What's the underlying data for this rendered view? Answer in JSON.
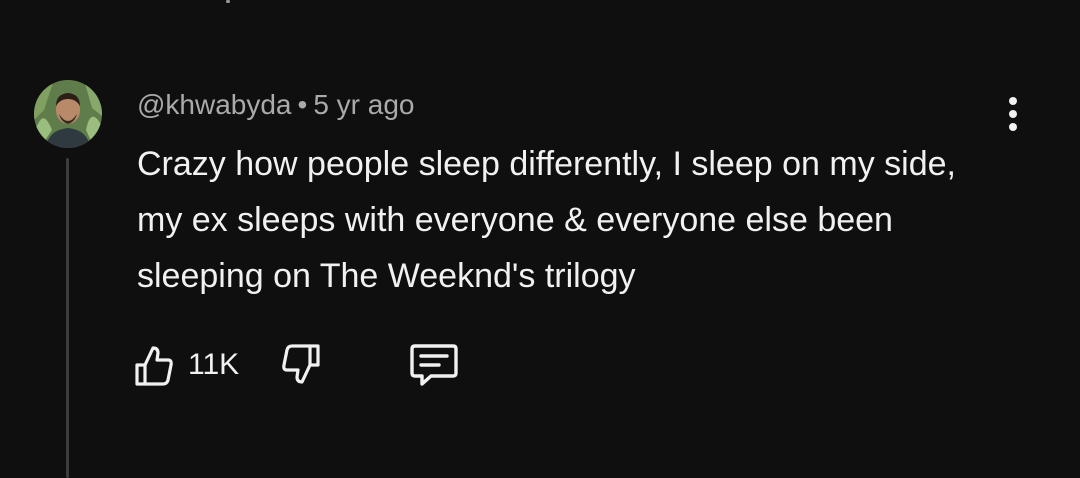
{
  "comment": {
    "author": "@khwabyda",
    "separator": "•",
    "time": "5 yr ago",
    "text": "Crazy how people sleep differently, I sleep on my side, my ex sleeps with everyone & everyone else been sleeping on The Weeknd's trilogy",
    "avatar_icon": "user-avatar-photo",
    "more_icon": "more-vertical-icon"
  },
  "actions": {
    "like_icon": "thumbs-up-icon",
    "like_count": "11K",
    "dislike_icon": "thumbs-down-icon",
    "reply_icon": "comment-reply-icon"
  },
  "colors": {
    "background": "#0f0f0f",
    "text_primary": "#f1f1f1",
    "text_secondary": "#aaaaaa",
    "thread_line": "#3d3d3d"
  }
}
